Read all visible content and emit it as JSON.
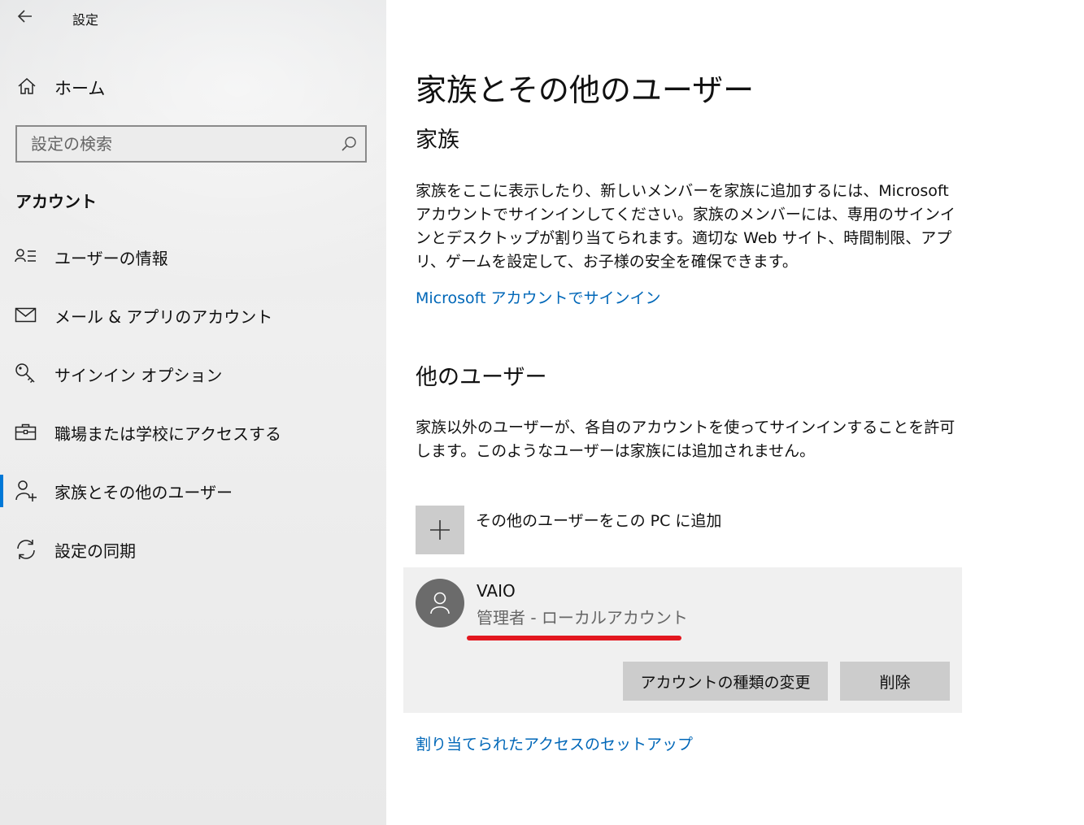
{
  "window": {
    "title": "設定"
  },
  "sidebar": {
    "home_label": "ホーム",
    "search": {
      "placeholder": "設定の検索"
    },
    "section_label": "アカウント",
    "items": [
      {
        "label": "ユーザーの情報",
        "icon": "user-info-icon"
      },
      {
        "label": "メール & アプリのアカウント",
        "icon": "mail-icon"
      },
      {
        "label": "サインイン オプション",
        "icon": "key-icon"
      },
      {
        "label": "職場または学校にアクセスする",
        "icon": "briefcase-icon"
      },
      {
        "label": "家族とその他のユーザー",
        "icon": "add-person-icon",
        "active": true
      },
      {
        "label": "設定の同期",
        "icon": "sync-icon"
      }
    ]
  },
  "main": {
    "title": "家族とその他のユーザー",
    "family": {
      "heading": "家族",
      "description": "家族をここに表示したり、新しいメンバーを家族に追加するには、Microsoft アカウントでサインインしてください。家族のメンバーには、専用のサインインとデスクトップが割り当てられます。適切な Web サイト、時間制限、アプリ、ゲームを設定して、お子様の安全を確保できます。",
      "signin_link": "Microsoft アカウントでサインイン"
    },
    "other_users": {
      "heading": "他のユーザー",
      "description": "家族以外のユーザーが、各自のアカウントを使ってサインインすることを許可します。このようなユーザーは家族には追加されません。",
      "add_label": "その他のユーザーをこの PC に追加",
      "user": {
        "name": "VAIO",
        "role": "管理者 - ローカルアカウント",
        "change_type_button": "アカウントの種類の変更",
        "delete_button": "削除"
      }
    },
    "assigned_access_link": "割り当てられたアクセスのセットアップ"
  },
  "colors": {
    "accent": "#0078d7",
    "link": "#0067b8",
    "highlight": "#e3171f"
  }
}
